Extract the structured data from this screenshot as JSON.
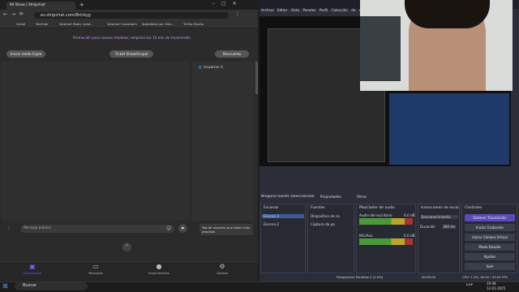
{
  "browser": {
    "tab_title": "Mi Show | Stripchat",
    "url": "es.stripchat.com/Brickyg",
    "bookmarks": [
      "Gmail",
      "YouTube",
      "Valorant Stats, Lead...",
      "Valorant Crosshairs",
      "Speedtest por Ookl...",
      "TikTok Studio"
    ],
    "promo": "Promoción para nuevos modelos: empieza tus 15 min de transmisión",
    "btn_spy": "Iniciar modo Espía",
    "btn_ticket": "Ticket Show/Grupal",
    "btn_discount": "Descuento",
    "users_label": "Usuarios",
    "users_count": "0",
    "msg_placeholder": "Mensaje público",
    "top_users": "Top de usuarios que dejan más propinas",
    "nav": [
      {
        "label": "Transmisión"
      },
      {
        "label": "Mensajes"
      },
      {
        "label": "Espectadores"
      },
      {
        "label": "Ajustes"
      }
    ]
  },
  "obs": {
    "menu": [
      "Archivo",
      "Editar",
      "Vista",
      "Paneles",
      "Perfil",
      "Colección de escenas"
    ],
    "no_source": "Ninguna fuente seleccionada",
    "properties": "Propiedades",
    "filters": "Filtros",
    "scenes_title": "Escenas",
    "scenes": [
      "Escena 3",
      "Escena 2"
    ],
    "sources_title": "Fuentes",
    "sources": [
      "Dispositivo de ca",
      "Captura de pa"
    ],
    "mixer_title": "Mezclador de audio",
    "mixer": [
      {
        "name": "Audio del escritorio",
        "db": "0.0 dB"
      },
      {
        "name": "Mic/Aux",
        "db": "0.0 dB"
      }
    ],
    "trans_title": "Transiciones de escenas",
    "trans_value": "Desvanecimiento",
    "duration_label": "Duración",
    "duration_value": "300 ms",
    "controls_title": "Controles",
    "controls": [
      "Detener Transmisión",
      "Iniciar Grabación",
      "Iniciar Cámara Virtual",
      "Modo Estudio",
      "Ajustes",
      "Salir"
    ],
    "status": "Fotogramas Perdidos 0 (0.0%)",
    "time": "00:00:00",
    "cpu": "CPU: 1.3%, 30.00 / 30.00 FPS"
  },
  "taskbar": {
    "search": "Buscar",
    "lang": "ESP",
    "clock": "19:48",
    "date": "12-01-2025"
  },
  "colors": {
    "accent": "#7b5cff",
    "stream_btn": "#5a4ab5"
  }
}
